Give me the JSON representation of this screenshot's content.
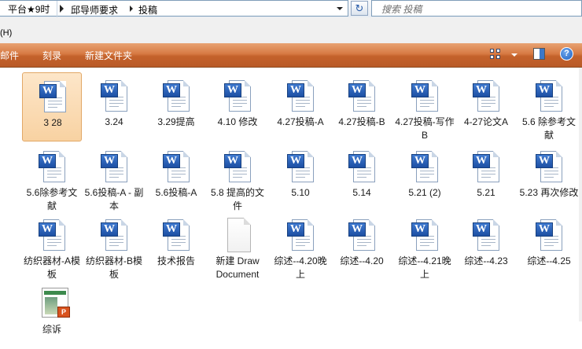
{
  "address": {
    "prefix": "平台★9时",
    "crumbs": [
      "邱导师要求",
      "投稿"
    ]
  },
  "search": {
    "placeholder": "搜索 投稿"
  },
  "menu": {
    "help_fragment": "(H)"
  },
  "toolbar": {
    "items": [
      "邮件",
      "刻录",
      "新建文件夹"
    ],
    "icons": [
      "view-grid-icon",
      "preview-pane-icon",
      "help-icon"
    ],
    "help_glyph": "?"
  },
  "files": [
    {
      "name": "3 28",
      "type": "word",
      "selected": true
    },
    {
      "name": "3.24",
      "type": "word"
    },
    {
      "name": "3.29提高",
      "type": "word"
    },
    {
      "name": "4.10 修改",
      "type": "word"
    },
    {
      "name": "4.27投稿-A",
      "type": "word"
    },
    {
      "name": "4.27投稿-B",
      "type": "word"
    },
    {
      "name": "4.27投稿-写作B",
      "type": "word"
    },
    {
      "name": "4-27论文A",
      "type": "word"
    },
    {
      "name": "5.6 除参考文献",
      "type": "word"
    },
    {
      "name": "5.6除参考文献",
      "type": "word"
    },
    {
      "name": "5.6投稿-A - 副本",
      "type": "word"
    },
    {
      "name": "5.6投稿-A",
      "type": "word"
    },
    {
      "name": "5.8 提高的文件",
      "type": "word"
    },
    {
      "name": "5.10",
      "type": "word"
    },
    {
      "name": "5.14",
      "type": "word"
    },
    {
      "name": "5.21 (2)",
      "type": "word"
    },
    {
      "name": "5.21",
      "type": "word"
    },
    {
      "name": "5.23 再次修改",
      "type": "word"
    },
    {
      "name": "纺织器材-A模板",
      "type": "word"
    },
    {
      "name": "纺织器材-B模板",
      "type": "word"
    },
    {
      "name": "技术报告",
      "type": "word"
    },
    {
      "name": "新建 Draw Document",
      "type": "draw"
    },
    {
      "name": "综述--4.20晚上",
      "type": "word"
    },
    {
      "name": "综述--4.20",
      "type": "word"
    },
    {
      "name": "综述--4.21晚上",
      "type": "word"
    },
    {
      "name": "综述--4.23",
      "type": "word"
    },
    {
      "name": "综述--4.25",
      "type": "word"
    },
    {
      "name": "综诉",
      "type": "ppt"
    }
  ],
  "labels": {
    "word_badge": "W",
    "ppt_badge": "P"
  },
  "colors": {
    "toolbar_accent": "#c4622b",
    "selection": "#f8d2a2",
    "word_blue": "#1d4fa3"
  }
}
